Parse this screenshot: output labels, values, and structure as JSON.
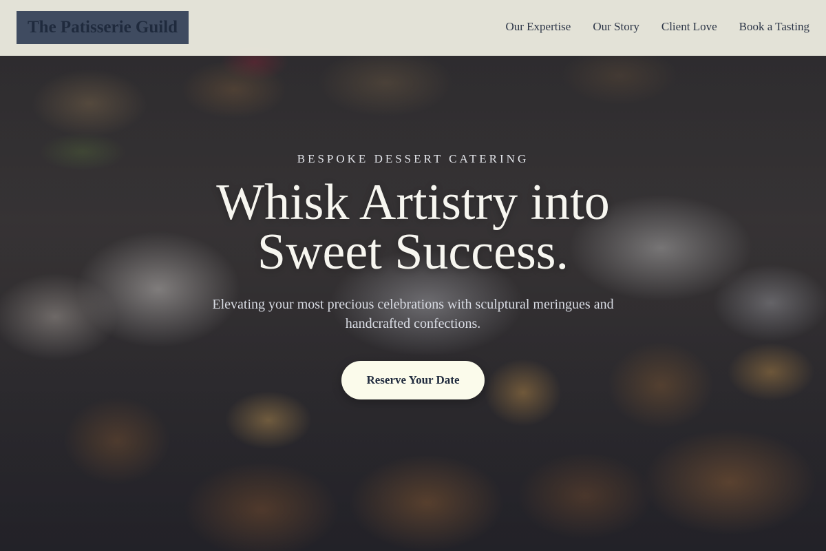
{
  "header": {
    "brand": "The Patisserie Guild",
    "nav": [
      {
        "label": "Our Expertise"
      },
      {
        "label": "Our Story"
      },
      {
        "label": "Client Love"
      },
      {
        "label": "Book a Tasting"
      }
    ]
  },
  "hero": {
    "eyebrow": "Bespoke Dessert Catering",
    "headline": "Whisk Artistry into Sweet Success.",
    "subhead": "Elevating your most precious celebrations with sculptural meringues and handcrafted confections.",
    "cta_label": "Reserve Your Date"
  },
  "colors": {
    "header_bg": "#f1f0e4",
    "brand_bg": "#3f4b60",
    "text_dark": "#1f2a3d",
    "cta_bg": "#fbfbeb",
    "headline": "#f7f6f0"
  }
}
